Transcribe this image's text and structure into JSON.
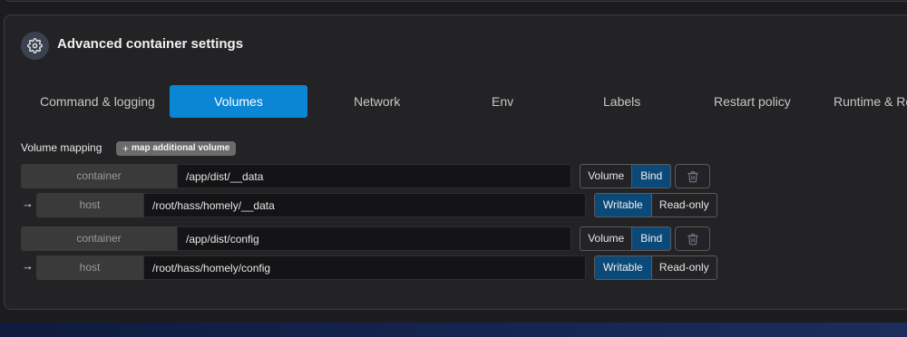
{
  "header": {
    "title": "Advanced container settings",
    "icon": "gear-icon"
  },
  "tabs": [
    {
      "label": "Command & logging",
      "active": false
    },
    {
      "label": "Volumes",
      "active": true
    },
    {
      "label": "Network",
      "active": false
    },
    {
      "label": "Env",
      "active": false
    },
    {
      "label": "Labels",
      "active": false
    },
    {
      "label": "Restart policy",
      "active": false
    },
    {
      "label": "Runtime & Re",
      "active": false
    }
  ],
  "volumes": {
    "section_label": "Volume mapping",
    "add_button": "map additional volume",
    "add_icon": "+",
    "mappings": [
      {
        "container_label": "container",
        "container_path": "/app/dist/__data",
        "type_options": [
          "Volume",
          "Bind"
        ],
        "type_selected": "Bind",
        "host_label": "host",
        "host_path": "/root/hass/homely/__data",
        "mode_options": [
          "Writable",
          "Read-only"
        ],
        "mode_selected": "Writable"
      },
      {
        "container_label": "container",
        "container_path": "/app/dist/config",
        "type_options": [
          "Volume",
          "Bind"
        ],
        "type_selected": "Bind",
        "host_label": "host",
        "host_path": "/root/hass/homely/config",
        "mode_options": [
          "Writable",
          "Read-only"
        ],
        "mode_selected": "Writable"
      }
    ]
  },
  "colors": {
    "accent": "#0a86d4",
    "toggle_active": "#0b4a78",
    "background": "#1c1c1e",
    "panel": "#232325"
  }
}
